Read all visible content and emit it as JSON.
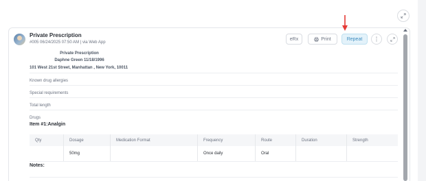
{
  "header": {
    "title": "Private Prescription",
    "subline": "#005  06/24/2025 07:50 AM  |  via Web App"
  },
  "actions": {
    "erx_label": "eRx",
    "print_label": "Print",
    "repeat_label": "Repeat"
  },
  "prescription": {
    "heading": "Private Prescription",
    "patient": "Daphne Green 11/18/1996",
    "address": "101 West 21st Street, Manhattan , New York, 10011"
  },
  "sections": {
    "allergies": "Known drug allergies",
    "special": "Special requirements",
    "length": "Total length",
    "drugs": "Drugs"
  },
  "item": {
    "title": "Item #1:Analgin"
  },
  "table": {
    "headers": [
      "Qty",
      "Dosage",
      "Medication Format",
      "Frequency",
      "Route",
      "Duration",
      "Strength"
    ],
    "rows": [
      [
        "",
        "50mg",
        "",
        "Once daily",
        "Oral",
        "",
        ""
      ]
    ]
  },
  "notes_label": "Notes:",
  "colors": {
    "accent": "#3e8cbf",
    "arrow": "#e53935"
  }
}
